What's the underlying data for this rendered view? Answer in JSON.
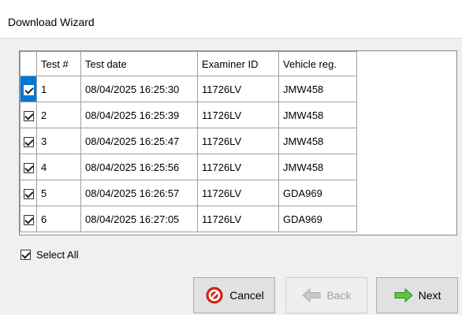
{
  "window": {
    "title": "Download Wizard"
  },
  "table": {
    "columns": [
      "",
      "Test #",
      "Test date",
      "Examiner ID",
      "Vehicle reg."
    ],
    "rows": [
      {
        "checked": true,
        "test_no": "1",
        "date": "08/04/2025 16:25:30",
        "examiner": "11726LV",
        "reg": "JMW458"
      },
      {
        "checked": true,
        "test_no": "2",
        "date": "08/04/2025 16:25:39",
        "examiner": "11726LV",
        "reg": "JMW458"
      },
      {
        "checked": true,
        "test_no": "3",
        "date": "08/04/2025 16:25:47",
        "examiner": "11726LV",
        "reg": "JMW458"
      },
      {
        "checked": true,
        "test_no": "4",
        "date": "08/04/2025 16:25:56",
        "examiner": "11726LV",
        "reg": "JMW458"
      },
      {
        "checked": true,
        "test_no": "5",
        "date": "08/04/2025 16:26:57",
        "examiner": "11726LV",
        "reg": "GDA969"
      },
      {
        "checked": true,
        "test_no": "6",
        "date": "08/04/2025 16:27:05",
        "examiner": "11726LV",
        "reg": "GDA969"
      }
    ]
  },
  "select_all": {
    "label": "Select All",
    "checked": true
  },
  "buttons": {
    "cancel": {
      "label": "Cancel",
      "icon": "cancel-icon"
    },
    "back": {
      "label": "Back",
      "icon": "arrow-left-icon",
      "enabled": false
    },
    "next": {
      "label": "Next",
      "icon": "arrow-right-icon"
    }
  },
  "colors": {
    "selection": "#0078d7",
    "cancel_red": "#e02b1c",
    "next_green": "#5ac83c"
  }
}
